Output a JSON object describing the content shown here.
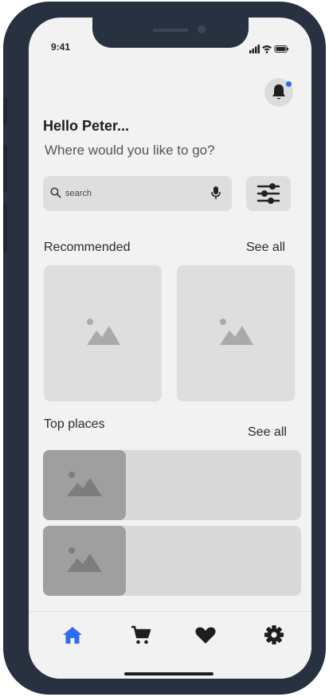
{
  "status_bar": {
    "time": "9:41",
    "icons": [
      "signal-icon",
      "wifi-icon",
      "battery-icon"
    ]
  },
  "header": {
    "greeting": "Hello Peter...",
    "question": "Where would you like to go?",
    "notification_icon": "bell-icon",
    "has_unread": true
  },
  "search": {
    "placeholder": "search",
    "value": "",
    "search_icon": "search-icon",
    "mic_icon": "mic-icon",
    "filter_icon": "filter-sliders-icon"
  },
  "recommended": {
    "title": "Recommended",
    "see_all": "See all",
    "cards": [
      {
        "image": "image-placeholder"
      },
      {
        "image": "image-placeholder"
      }
    ]
  },
  "top_places": {
    "title": "Top places",
    "see_all": "See all",
    "items": [
      {
        "image": "image-placeholder"
      },
      {
        "image": "image-placeholder"
      }
    ]
  },
  "bottom_nav": {
    "items": [
      {
        "icon": "home-icon",
        "active": true
      },
      {
        "icon": "cart-icon",
        "active": false
      },
      {
        "icon": "heart-icon",
        "active": false
      },
      {
        "icon": "settings-gear-icon",
        "active": false
      }
    ]
  },
  "colors": {
    "accent": "#2f6bf0",
    "frame": "#283140",
    "screen_bg": "#f2f2f2",
    "placeholder_bg": "#dedede",
    "thumb_bg": "#9f9f9f",
    "icon_dark": "#1e1e1e"
  }
}
